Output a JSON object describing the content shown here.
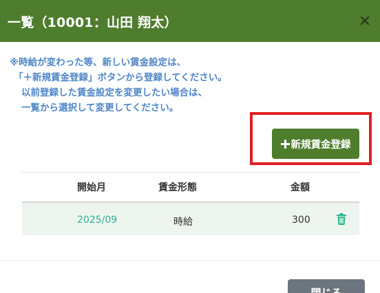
{
  "modal": {
    "title": "一覧（10001：山田 翔太）",
    "close_icon": "close-icon"
  },
  "notice": {
    "lines": [
      "※時給が変わった等、新しい賃金設定は、",
      "「＋新規賃金登録」ボタンから登録してください。",
      "以前登録した賃金設定を変更したい場合は、",
      "一覧から選択して変更してください。"
    ],
    "color": "#4f86c6"
  },
  "toolbar": {
    "new_wage_label": "新規賃金登録",
    "new_wage_icon": "plus-icon",
    "highlight_color": "#e01e24"
  },
  "table": {
    "headers": {
      "start_month": "開始月",
      "wage_type": "賃金形態",
      "amount": "金額"
    },
    "rows": [
      {
        "start_month": "2025/09",
        "wage_type": "時給",
        "amount": "300",
        "action_icon": "trash-icon"
      }
    ]
  },
  "footer": {
    "close_label": "閉じる"
  },
  "colors": {
    "primary_green": "#4e7d2e",
    "link_teal": "#2bb38f",
    "row_bg": "#eef5ef",
    "secondary_gray": "#6c757d"
  }
}
